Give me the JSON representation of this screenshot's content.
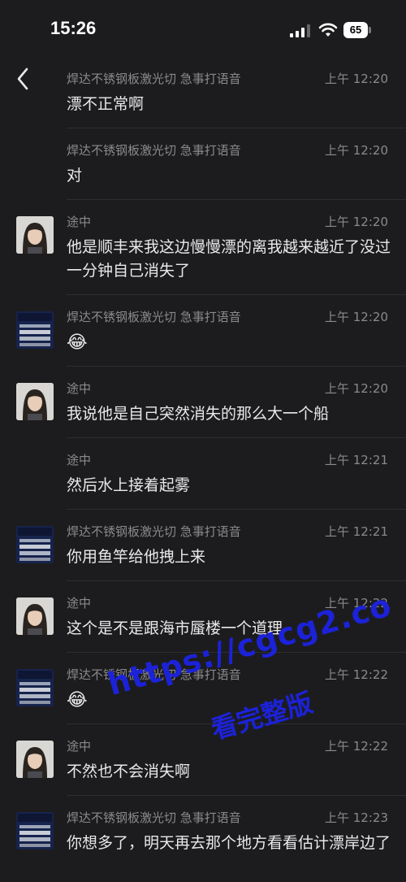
{
  "status_bar": {
    "time": "15:26",
    "battery": "65",
    "icons": [
      "signal-icon",
      "wifi-icon",
      "battery-icon"
    ]
  },
  "nav": {
    "back_icon": "chevron-left-icon"
  },
  "messages": [
    {
      "sender": "焊达不锈钢板激光切 急事打语音",
      "time": "上午 12:20",
      "text": "漂不正常啊",
      "avatar": "none"
    },
    {
      "sender": "焊达不锈钢板激光切 急事打语音",
      "time": "上午 12:20",
      "text": "对",
      "avatar": "none"
    },
    {
      "sender": "途中",
      "time": "上午 12:20",
      "text": "他是顺丰来我这边慢慢漂的离我越来越近了没过一分钟自己消失了",
      "avatar": "girl"
    },
    {
      "sender": "焊达不锈钢板激光切 急事打语音",
      "time": "上午 12:20",
      "text": "😂",
      "avatar": "steel"
    },
    {
      "sender": "途中",
      "time": "上午 12:20",
      "text": "我说他是自己突然消失的那么大一个船",
      "avatar": "girl"
    },
    {
      "sender": "途中",
      "time": "上午 12:21",
      "text": "然后水上接着起雾",
      "avatar": "none"
    },
    {
      "sender": "焊达不锈钢板激光切 急事打语音",
      "time": "上午 12:21",
      "text": "你用鱼竿给他拽上来",
      "avatar": "steel"
    },
    {
      "sender": "途中",
      "time": "上午 12:22",
      "text": "这个是不是跟海市蜃楼一个道理",
      "avatar": "girl"
    },
    {
      "sender": "焊达不锈钢板激光切 急事打语音",
      "time": "上午 12:22",
      "text": "😂",
      "avatar": "steel"
    },
    {
      "sender": "途中",
      "time": "上午 12:22",
      "text": "不然也不会消失啊",
      "avatar": "girl"
    },
    {
      "sender": "焊达不锈钢板激光切 急事打语音",
      "time": "上午 12:23",
      "text": "你想多了，明天再去那个地方看看估计漂岸边了",
      "avatar": "steel"
    }
  ],
  "avatar_steel_label": "不锈钢板",
  "watermark": {
    "url": "https://cgcg2.co",
    "text": "看完整版"
  }
}
